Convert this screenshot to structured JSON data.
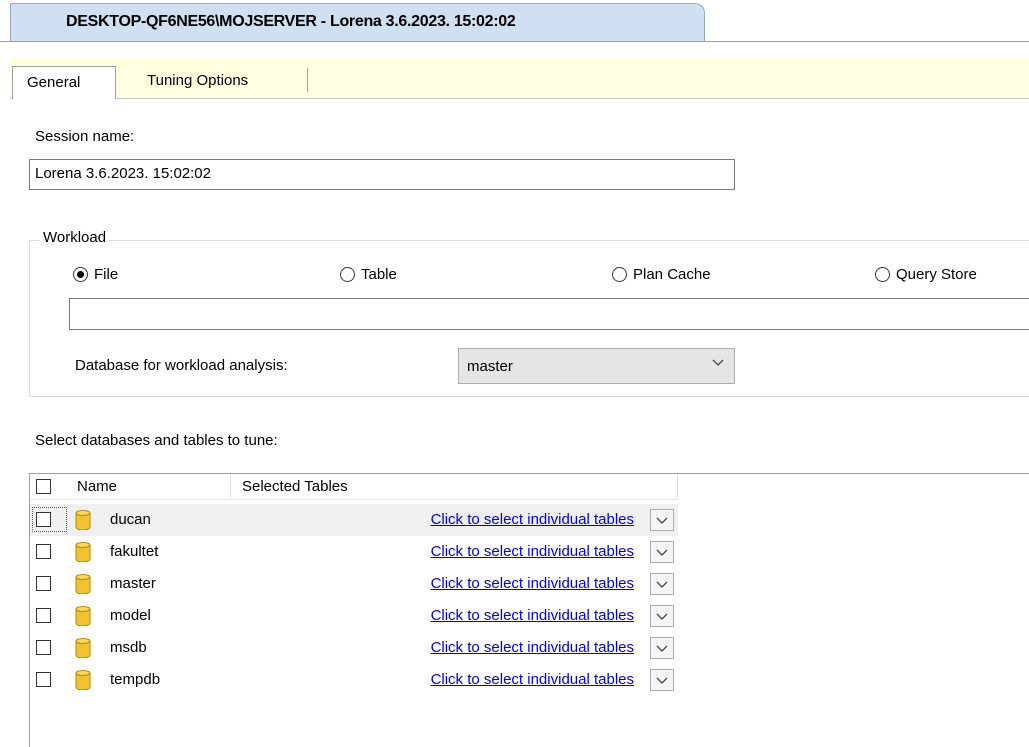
{
  "window": {
    "document_tab_title": "DESKTOP-QF6NE56\\MOJSERVER - Lorena 3.6.2023. 15:02:02"
  },
  "tabs": [
    {
      "label": "General",
      "active": true
    },
    {
      "label": "Tuning Options",
      "active": false
    }
  ],
  "session": {
    "label": "Session name:",
    "value": "Lorena 3.6.2023. 15:02:02"
  },
  "workload": {
    "group_title": "Workload",
    "options": [
      {
        "label": "File",
        "checked": true
      },
      {
        "label": "Table",
        "checked": false
      },
      {
        "label": "Plan Cache",
        "checked": false
      },
      {
        "label": "Query Store",
        "checked": false
      }
    ],
    "file_path": "",
    "db_label": "Database for workload analysis:",
    "db_value": "master"
  },
  "databases": {
    "section_label": "Select databases and tables to tune:",
    "columns": [
      "Name",
      "Selected Tables"
    ],
    "rows": [
      {
        "name": "ducan",
        "tables": "Click to select individual tables",
        "checked": false
      },
      {
        "name": "fakultet",
        "tables": "Click to select individual tables",
        "checked": false
      },
      {
        "name": "master",
        "tables": "Click to select individual tables",
        "checked": false
      },
      {
        "name": "model",
        "tables": "Click to select individual tables",
        "checked": false
      },
      {
        "name": "msdb",
        "tables": "Click to select individual tables",
        "checked": false
      },
      {
        "name": "tempdb",
        "tables": "Click to select individual tables",
        "checked": false
      }
    ]
  },
  "colors": {
    "doc_tab_bg": "#cfe0f2",
    "tab_strip_bg": "#ffffe1",
    "link": "#0000ee",
    "db_icon": "#f2c230"
  },
  "icons": {
    "radio_checked": "radio-checked-icon",
    "radio_unchecked": "radio-unchecked-icon",
    "checkbox": "checkbox-icon",
    "database": "database-cylinder-icon",
    "chevron": "chevron-down-icon"
  }
}
